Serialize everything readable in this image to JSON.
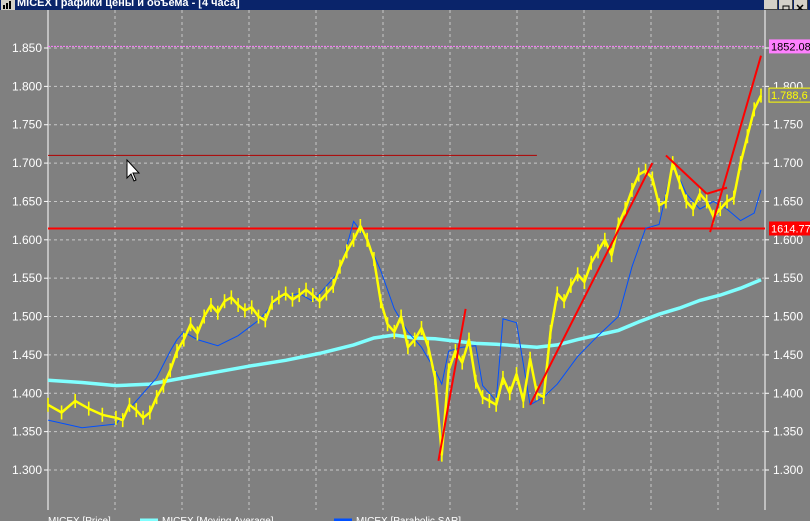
{
  "window": {
    "title": "MICEX Графики цены и объема - [4 часа]"
  },
  "colors": {
    "background": "#808080",
    "grid": "#c8c8c8",
    "price": "#ffff00",
    "moving_average": "#80ffff",
    "sar": "#0050ff",
    "trendline": "#ff0000",
    "upper_level": "#ff80ff",
    "support_level": "#ff0000",
    "resistance_line": "#b00000",
    "title_bar": "#0a246a"
  },
  "chart_data": {
    "type": "line",
    "y_ticks": [
      "1.850",
      "1.800",
      "1.750",
      "1.700",
      "1.650",
      "1.600",
      "1.550",
      "1.500",
      "1.450",
      "1.400",
      "1.350",
      "1.300"
    ],
    "y_tick_values": [
      1850,
      1800,
      1750,
      1700,
      1650,
      1600,
      1550,
      1500,
      1450,
      1400,
      1350,
      1300
    ],
    "ylim": [
      1265,
      1880
    ],
    "xlim": [
      0,
      100
    ],
    "grid": true,
    "series": [
      {
        "name": "MICEX [Price]",
        "style": "price",
        "values": [
          [
            0,
            1385
          ],
          [
            2,
            1375
          ],
          [
            4,
            1390
          ],
          [
            6,
            1380
          ],
          [
            8,
            1372
          ],
          [
            10,
            1368
          ],
          [
            11,
            1365
          ],
          [
            12,
            1385
          ],
          [
            13,
            1378
          ],
          [
            14,
            1368
          ],
          [
            15,
            1375
          ],
          [
            16,
            1395
          ],
          [
            17,
            1410
          ],
          [
            18,
            1430
          ],
          [
            19,
            1455
          ],
          [
            20,
            1470
          ],
          [
            21,
            1490
          ],
          [
            22,
            1478
          ],
          [
            23,
            1500
          ],
          [
            24,
            1515
          ],
          [
            25,
            1505
          ],
          [
            26,
            1520
          ],
          [
            27,
            1525
          ],
          [
            28,
            1515
          ],
          [
            29,
            1508
          ],
          [
            30,
            1512
          ],
          [
            31,
            1500
          ],
          [
            32,
            1495
          ],
          [
            33,
            1518
          ],
          [
            34,
            1525
          ],
          [
            35,
            1530
          ],
          [
            36,
            1522
          ],
          [
            37,
            1528
          ],
          [
            38,
            1535
          ],
          [
            39,
            1528
          ],
          [
            40,
            1520
          ],
          [
            41,
            1530
          ],
          [
            42,
            1540
          ],
          [
            43,
            1565
          ],
          [
            44,
            1585
          ],
          [
            45,
            1600
          ],
          [
            46,
            1618
          ],
          [
            47,
            1600
          ],
          [
            48,
            1575
          ],
          [
            49,
            1520
          ],
          [
            50,
            1490
          ],
          [
            51,
            1480
          ],
          [
            52,
            1500
          ],
          [
            53,
            1460
          ],
          [
            54,
            1470
          ],
          [
            55,
            1485
          ],
          [
            56,
            1460
          ],
          [
            57,
            1420
          ],
          [
            58,
            1320
          ],
          [
            59,
            1430
          ],
          [
            60,
            1455
          ],
          [
            61,
            1440
          ],
          [
            62,
            1470
          ],
          [
            63,
            1415
          ],
          [
            64,
            1395
          ],
          [
            65,
            1390
          ],
          [
            66,
            1385
          ],
          [
            67,
            1420
          ],
          [
            68,
            1400
          ],
          [
            69,
            1425
          ],
          [
            70,
            1390
          ],
          [
            71,
            1445
          ],
          [
            72,
            1400
          ],
          [
            73,
            1395
          ],
          [
            74,
            1480
          ],
          [
            75,
            1530
          ],
          [
            76,
            1520
          ],
          [
            77,
            1540
          ],
          [
            78,
            1555
          ],
          [
            79,
            1545
          ],
          [
            80,
            1570
          ],
          [
            81,
            1585
          ],
          [
            82,
            1600
          ],
          [
            83,
            1580
          ],
          [
            84,
            1620
          ],
          [
            85,
            1640
          ],
          [
            86,
            1665
          ],
          [
            87,
            1685
          ],
          [
            88,
            1690
          ],
          [
            89,
            1680
          ],
          [
            90,
            1645
          ],
          [
            91,
            1650
          ],
          [
            92,
            1700
          ],
          [
            93,
            1675
          ],
          [
            94,
            1650
          ],
          [
            95,
            1640
          ],
          [
            96,
            1660
          ],
          [
            97,
            1650
          ],
          [
            98,
            1630
          ],
          [
            99,
            1640
          ],
          [
            100,
            1650
          ],
          [
            101,
            1655
          ],
          [
            102,
            1700
          ],
          [
            103,
            1735
          ],
          [
            104,
            1770
          ],
          [
            105,
            1788
          ]
        ]
      },
      {
        "name": "MICEX [Moving Average]",
        "style": "ma",
        "values": [
          [
            0,
            1417
          ],
          [
            5,
            1414
          ],
          [
            10,
            1410
          ],
          [
            15,
            1412
          ],
          [
            20,
            1420
          ],
          [
            25,
            1428
          ],
          [
            30,
            1436
          ],
          [
            35,
            1443
          ],
          [
            40,
            1452
          ],
          [
            45,
            1463
          ],
          [
            48,
            1472
          ],
          [
            51,
            1476
          ],
          [
            54,
            1472
          ],
          [
            57,
            1471
          ],
          [
            60,
            1468
          ],
          [
            63,
            1465
          ],
          [
            66,
            1464
          ],
          [
            69,
            1462
          ],
          [
            72,
            1460
          ],
          [
            75,
            1463
          ],
          [
            78,
            1470
          ],
          [
            81,
            1476
          ],
          [
            84,
            1482
          ],
          [
            87,
            1493
          ],
          [
            90,
            1503
          ],
          [
            93,
            1511
          ],
          [
            96,
            1521
          ],
          [
            99,
            1528
          ],
          [
            102,
            1537
          ],
          [
            105,
            1548
          ]
        ]
      },
      {
        "name": "MICEX [Parabolic SAR]",
        "style": "sar",
        "values": [
          [
            0,
            1365
          ],
          [
            5,
            1355
          ],
          [
            10,
            1360
          ],
          [
            13,
            1390
          ],
          [
            16,
            1420
          ],
          [
            18,
            1455
          ],
          [
            19,
            1470
          ],
          [
            20,
            1480
          ],
          [
            22,
            1470
          ],
          [
            25,
            1462
          ],
          [
            28,
            1475
          ],
          [
            31,
            1495
          ],
          [
            34,
            1525
          ],
          [
            37,
            1530
          ],
          [
            39,
            1520
          ],
          [
            41,
            1540
          ],
          [
            43,
            1560
          ],
          [
            45,
            1624
          ],
          [
            47,
            1600
          ],
          [
            49,
            1560
          ],
          [
            51,
            1510
          ],
          [
            53,
            1480
          ],
          [
            55,
            1460
          ],
          [
            57,
            1430
          ],
          [
            58,
            1412
          ],
          [
            59,
            1455
          ],
          [
            61,
            1460
          ],
          [
            63,
            1462
          ],
          [
            64,
            1410
          ],
          [
            66,
            1390
          ],
          [
            67,
            1497
          ],
          [
            69,
            1492
          ],
          [
            71,
            1385
          ],
          [
            73,
            1395
          ],
          [
            75,
            1412
          ],
          [
            78,
            1448
          ],
          [
            81,
            1475
          ],
          [
            84,
            1500
          ],
          [
            86,
            1565
          ],
          [
            88,
            1615
          ],
          [
            90,
            1620
          ],
          [
            92,
            1700
          ],
          [
            94,
            1660
          ],
          [
            96,
            1640
          ],
          [
            98,
            1650
          ],
          [
            100,
            1640
          ],
          [
            102,
            1625
          ],
          [
            104,
            1635
          ],
          [
            105,
            1665
          ]
        ]
      }
    ],
    "levels": [
      {
        "name": "upper",
        "value": 1852.08,
        "label": "1852.08",
        "x_start": 0
      },
      {
        "name": "support",
        "value": 1614.77,
        "label": "1614.77",
        "x_start": 0
      },
      {
        "name": "resistance",
        "value": 1710,
        "label": "",
        "x_start": 0,
        "x_end": 72
      }
    ],
    "trendlines": [
      {
        "from": [
          57.5,
          1312
        ],
        "to": [
          61.5,
          1510
        ]
      },
      {
        "from": [
          71,
          1385
        ],
        "to": [
          89,
          1700
        ]
      },
      {
        "from": [
          91,
          1710
        ],
        "to": [
          97,
          1660
        ]
      },
      {
        "from": [
          97,
          1660
        ],
        "to": [
          100,
          1668
        ]
      },
      {
        "from": [
          97.5,
          1610
        ],
        "to": [
          105,
          1840
        ]
      }
    ],
    "current_value_label": "1.788,6",
    "current_value": 1788.6,
    "legend": [
      "MICEX [Price]",
      "MICEX [Moving Average]",
      "MICEX [Parabolic SAR]"
    ]
  }
}
